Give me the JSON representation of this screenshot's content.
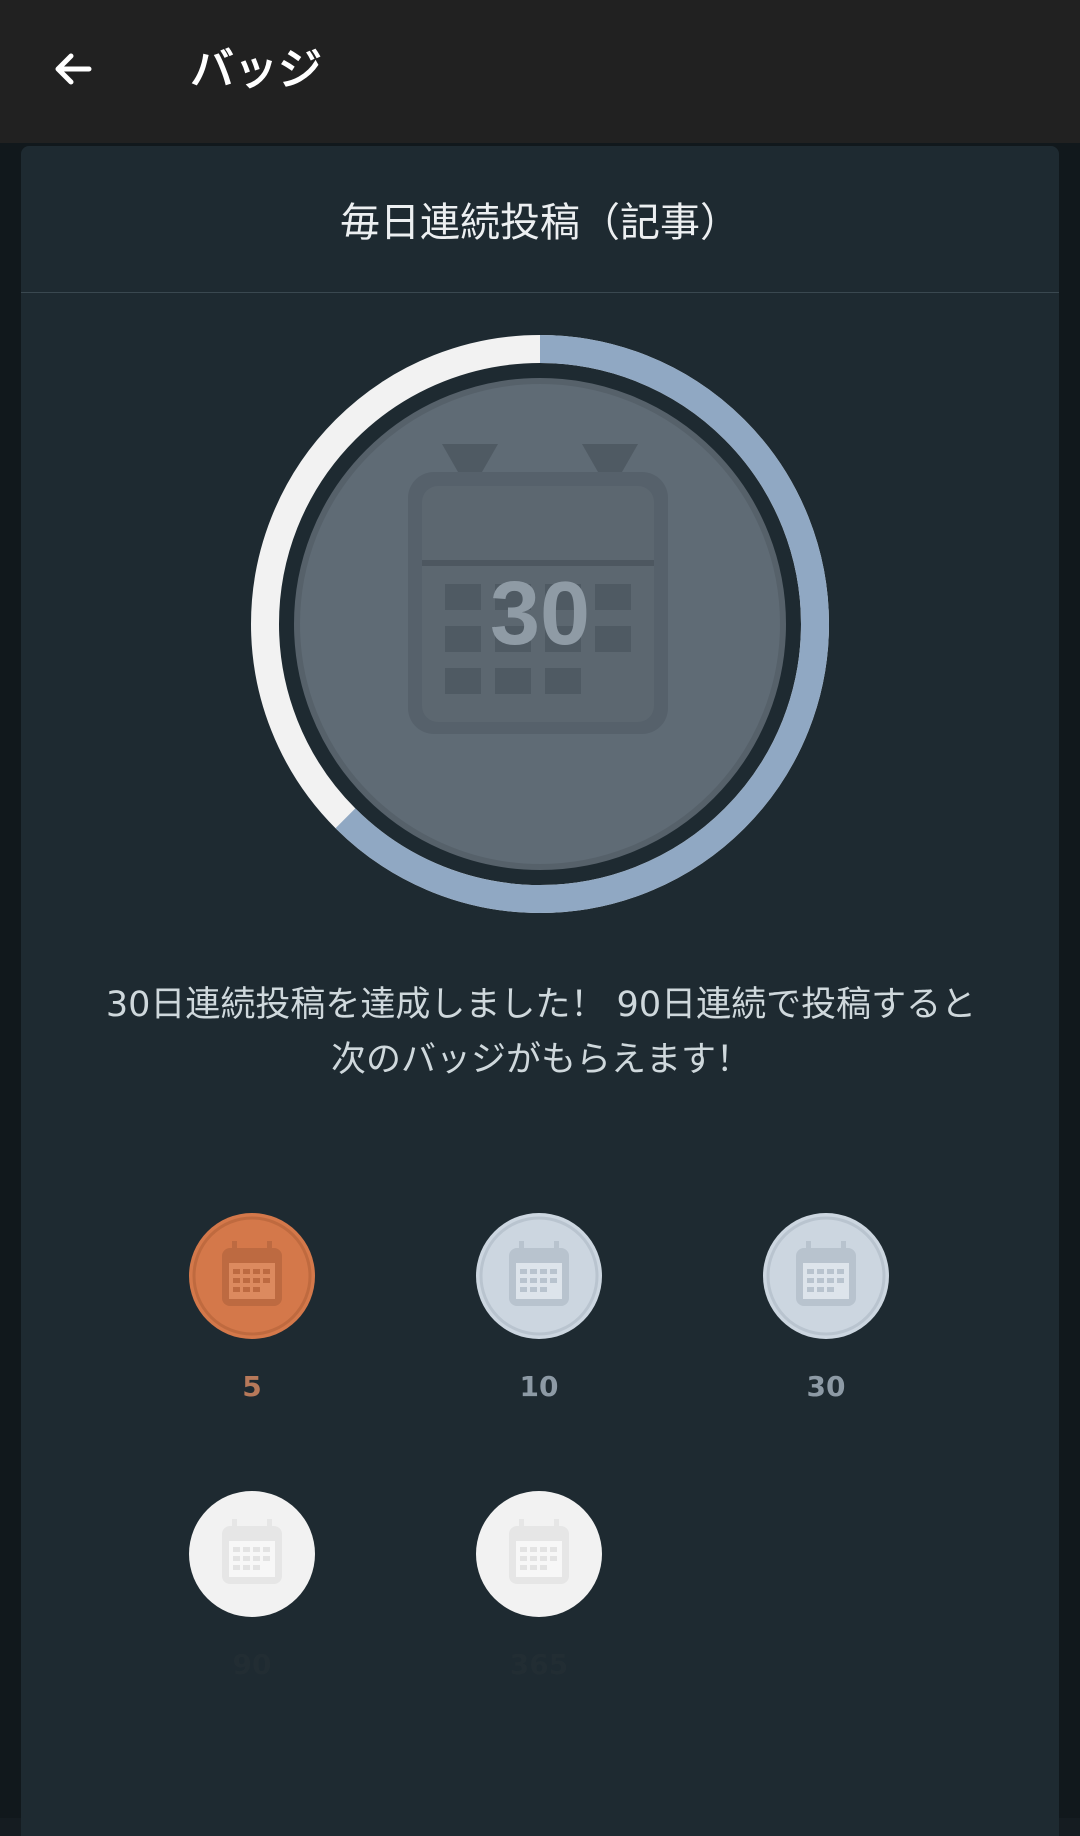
{
  "topbar": {
    "title": "バッジ"
  },
  "modal": {
    "title": "毎日連続投稿（記事）",
    "current_badge_number": "30",
    "message": "30日連続投稿を達成しました！ 90日連続で投稿すると次のバッジがもらえます！"
  },
  "badges": [
    {
      "label": "5",
      "state": "achieved-bronze"
    },
    {
      "label": "10",
      "state": "achieved-silver"
    },
    {
      "label": "30",
      "state": "achieved-silver"
    },
    {
      "label": "90",
      "state": "locked"
    },
    {
      "label": "365",
      "state": "locked"
    }
  ],
  "colors": {
    "topbar_bg": "#212121",
    "modal_bg": "#1e2a31",
    "ring_progress": "#90a8c3",
    "ring_remaining": "#f2f2f2",
    "bronze": "#d4784a",
    "silver": "#ccd6e0",
    "locked": "#f2f2f2"
  }
}
